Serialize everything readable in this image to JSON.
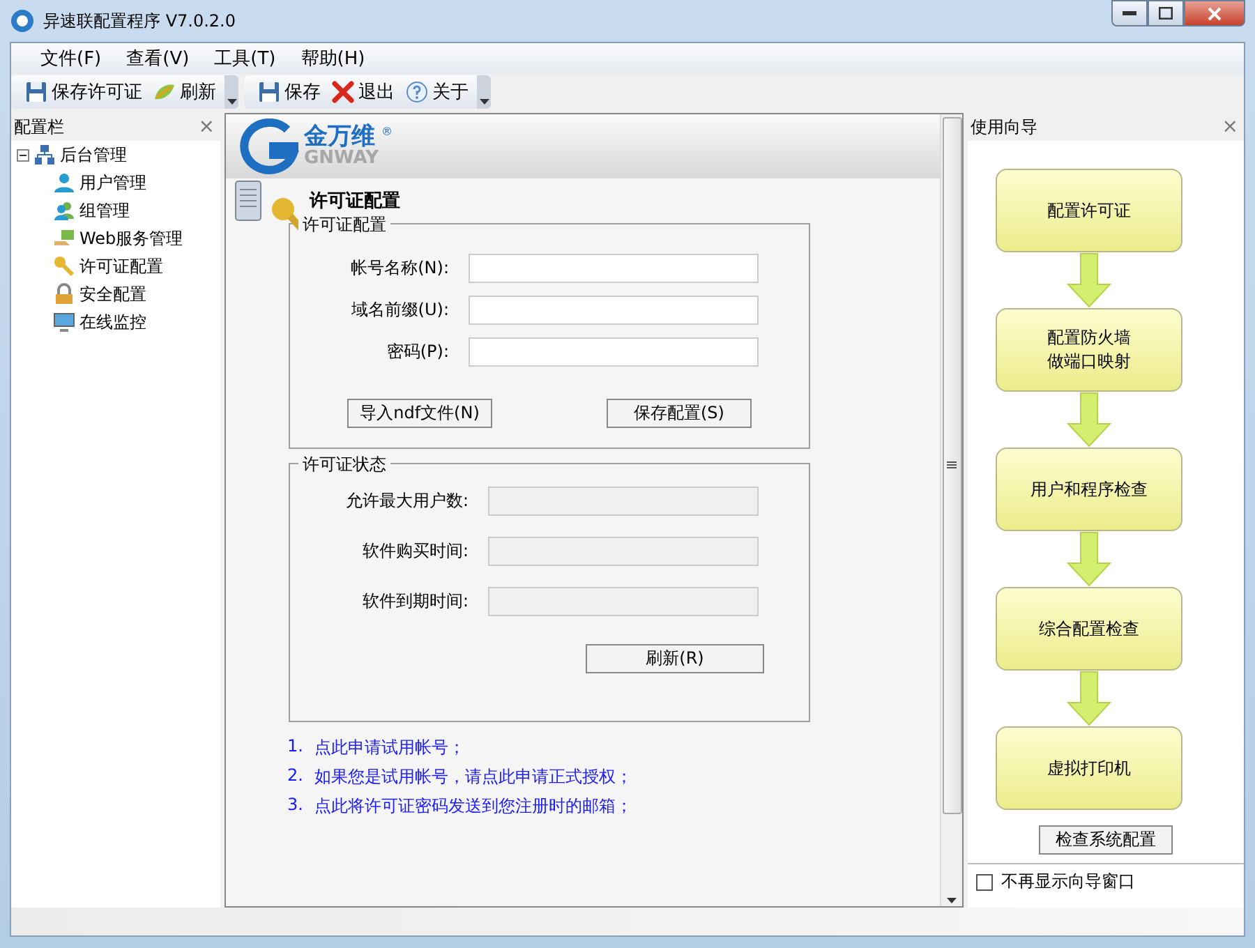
{
  "window": {
    "title": "异速联配置程序 V7.0.2.0"
  },
  "menu": [
    "文件(F)",
    "查看(V)",
    "工具(T)",
    "帮助(H)"
  ],
  "toolbar": [
    {
      "kind": "save-license",
      "label": "保存许可证"
    },
    {
      "kind": "refresh",
      "label": "刷新"
    },
    {
      "kind": "separator"
    },
    {
      "kind": "save",
      "label": "保存"
    },
    {
      "kind": "exit",
      "label": "退出"
    },
    {
      "kind": "about",
      "label": "关于"
    }
  ],
  "sidebar": {
    "title": "配置栏",
    "close": "×",
    "tree": [
      {
        "label": "后台管理",
        "expanded": true,
        "children": [
          {
            "label": "用户管理"
          },
          {
            "label": "组管理"
          },
          {
            "label": "Web服务管理"
          },
          {
            "label": "许可证配置"
          },
          {
            "label": "安全配置"
          },
          {
            "label": "在线监控"
          }
        ]
      }
    ]
  },
  "content": {
    "logo": {
      "name": "金万维",
      "sub": "GNWAY",
      "mark": "®"
    },
    "heading": "许可证配置",
    "license_group": {
      "title": "许可证配置",
      "fields": [
        {
          "label": "帐号名称(N):"
        },
        {
          "label": "域名前缀(U):"
        },
        {
          "label": "密码(P):"
        }
      ],
      "buttons": [
        "导入ndf文件(N)",
        "保存配置(S)"
      ]
    },
    "status_group": {
      "title": "许可证状态",
      "fields": [
        {
          "label": "允许最大用户数:",
          "disabled": true
        },
        {
          "label": "软件购买时间:",
          "disabled": true
        },
        {
          "label": "软件到期时间:",
          "disabled": true
        }
      ],
      "button": "刷新(R)"
    },
    "links": [
      {
        "number": "1.",
        "text": "点此申请试用帐号；"
      },
      {
        "number": "2.",
        "text": "如果您是试用帐号，请点此申请正式授权；"
      },
      {
        "number": "3.",
        "text": "点此将许可证密码发送到您注册时的邮箱；"
      }
    ]
  },
  "wizard": {
    "title": "使用向导",
    "close": "×",
    "steps": [
      {
        "lines": [
          "配置许可证"
        ]
      },
      {
        "lines": [
          "配置防火墙",
          "做端口映射"
        ]
      },
      {
        "lines": [
          "用户和程序检查"
        ]
      },
      {
        "lines": [
          "综合配置检查"
        ]
      },
      {
        "lines": [
          "虚拟打印机"
        ]
      }
    ],
    "check_button": "检查系统配置",
    "dont_show": {
      "label": "不再显示向导窗口",
      "checked": false
    }
  }
}
